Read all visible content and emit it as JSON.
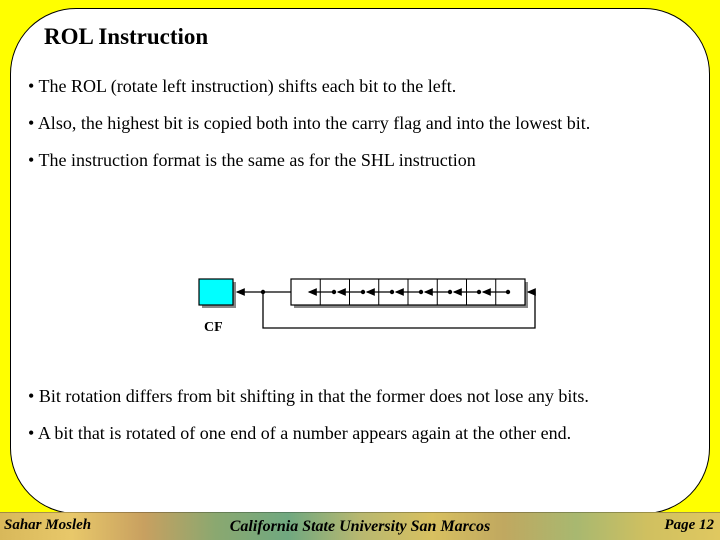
{
  "title": "ROL Instruction",
  "bullets_top": [
    "The ROL (rotate left instruction) shifts each bit to the left.",
    "Also, the highest bit is copied both into the carry flag and into the lowest bit.",
    "The instruction format is the same as for the SHL instruction"
  ],
  "bullets_bottom": [
    "Bit rotation differs from bit shifting in that the former does not lose any bits.",
    "A bit that is rotated of one end of a number appears again at the other end."
  ],
  "diagram": {
    "cf_label": "CF",
    "bit_count": 8
  },
  "footer": {
    "author": "Sahar Mosleh",
    "institution": "California State University San Marcos",
    "page_label": "Page",
    "page_number": "12"
  }
}
